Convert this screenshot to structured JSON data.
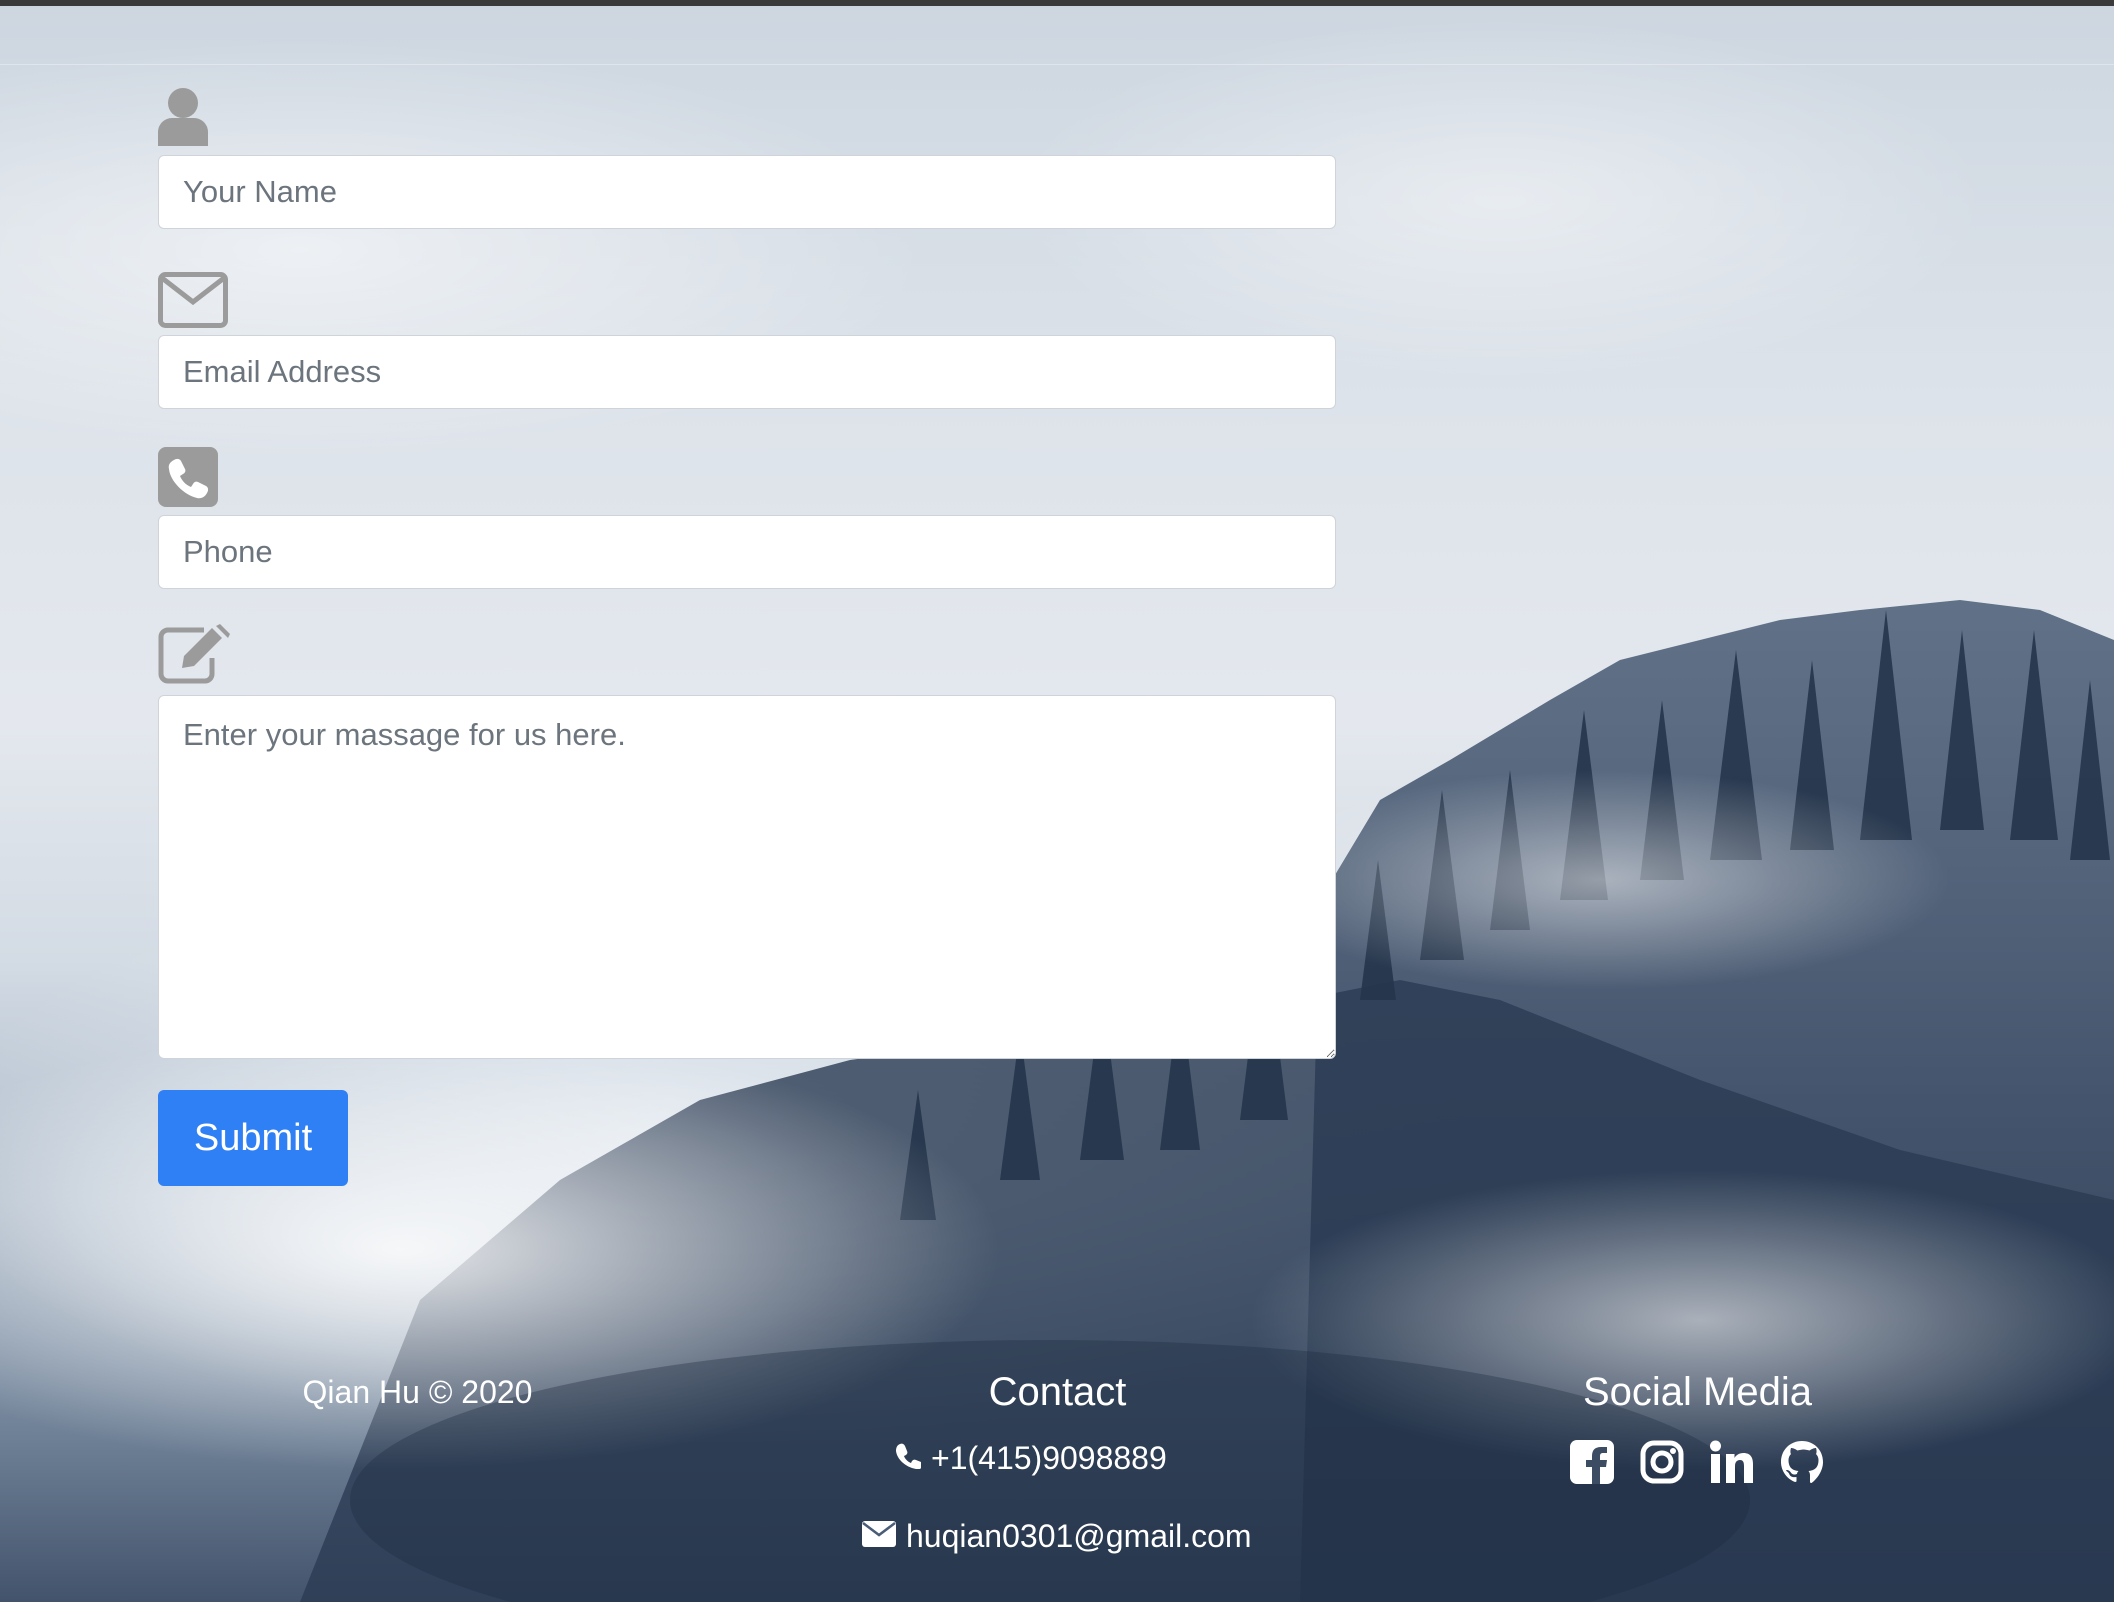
{
  "form": {
    "name_placeholder": "Your Name",
    "email_placeholder": "Email Address",
    "phone_placeholder": "Phone",
    "message_placeholder": "Enter your massage for us here.",
    "submit_label": "Submit",
    "icons": [
      "user-icon",
      "envelope-icon",
      "phone-square-icon",
      "edit-icon"
    ]
  },
  "footer": {
    "copyright": "Qian Hu © 2020",
    "contact": {
      "title": "Contact",
      "phone": "+1(415)9098889",
      "email": "huqian0301@gmail.com"
    },
    "social": {
      "title": "Social Media",
      "icons": [
        "facebook-icon",
        "instagram-icon",
        "linkedin-icon",
        "github-icon"
      ]
    }
  },
  "colors": {
    "accent": "#2f7ff5",
    "icon_gray": "#9b9b9b",
    "input_border": "#ced4da",
    "footer_text": "#ffffff"
  }
}
